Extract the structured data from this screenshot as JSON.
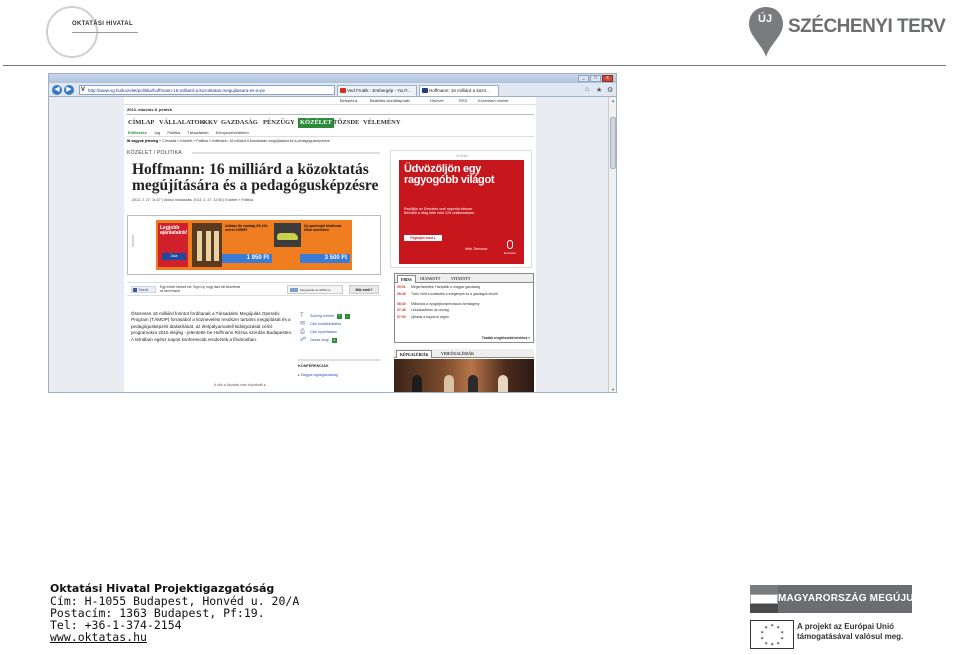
{
  "header": {
    "left_logo_text": "OKTATÁSI HIVATAL",
    "right_logo": {
      "prefix": "ÚJ",
      "name": "SZÉCHENYI TERV"
    }
  },
  "browser": {
    "url": "http://www.vg.hu/kozelet/politika/hoffmann-16-milliard-a-kozoktatas-megujitasara-es-a-pe",
    "tabs": [
      {
        "label": "Ved Fruttik - Embergép - YouT...",
        "icon": "youtube-icon"
      },
      {
        "label": "Hoffmann: 16 milliárd a közö...",
        "icon": "vg-icon"
      }
    ],
    "window_buttons": [
      "_",
      "□",
      "x"
    ],
    "favorites_bar": [
      "Belépés ▸",
      "Beállítás kezdőlapnak!",
      "Hírlevél",
      "RSS",
      "Kövessen minket"
    ]
  },
  "page": {
    "date": "2013. március 8. péntek",
    "main_nav": [
      "CÍMLAP",
      "VÁLLALATOK",
      "KKV",
      "GAZDASÁG",
      "PÉNZÜGY",
      "KÖZÉLET",
      "TŐZSDE",
      "VÉLEMÉNY"
    ],
    "main_nav_active": "KÖZÉLET",
    "sub_nav": [
      "Előfizetés",
      "Jog",
      "Politika",
      "Társadalom",
      "Környezetvédelem"
    ],
    "breadcrumb_prefix": "Itt vagyok jelenleg",
    "breadcrumb": "Címoldal  »  Közélet  »  Politika  »  Hoffmann: 16 milliárd a közoktatás megújítására és a pedagógusképzésre",
    "section": "KÖZÉLET / POLITIKA",
    "headline": "Hoffmann: 16 milliárd a közoktatás megújítására és a pedagógusképzésre",
    "meta": "2013. 2. 27. 11:07 | Utolsó módosítás: 2013. 2. 27. 12:50 | Közélet » Politika",
    "ad": {
      "label": "Hirdetés",
      "left_title": "Legjobb ajánlataink!",
      "left_brand": "Alza",
      "product1_text": "Adidas fiú nadrág 05-164 méret 1950Ft",
      "product1_price": "1 950 Ft",
      "product2_text": "Új sportcipő kisfiúnak több méretben",
      "product2_price": "3 500 Ft"
    },
    "share": {
      "like": "Tetszik",
      "fb_text": "Egy ember kedveli ezt. Sign Up, hogy lásd mit kedvelnek az ismerőseid.",
      "share_button": "Megosztás az iWIW-en",
      "mi_ez": "Mik ezek?"
    },
    "lead": "Összesen 16 milliárd forintot fordítanak a Társadalmi Megújulás Operatív Program (TÁMOP) forrásából a köznevelési rendszer tartalmi megújítását és a pedagógusképzés átalakítását, az életpályamodell kidolgozását célzó programokra 2015 elejéig - jelentette be Hoffmann Rózsa szerdán Budapesten. A témában egész napos konferenciát rendeztek a fővárosban.",
    "tools": [
      {
        "icon": "text-size-icon",
        "label": "Szöveg mérete",
        "extra": [
          "+",
          "-"
        ]
      },
      {
        "icon": "mail-icon",
        "label": "Cikk továbbküldése",
        "extra": []
      },
      {
        "icon": "print-icon",
        "label": "Cikk nyomtatása",
        "extra": []
      },
      {
        "icon": "share-icon",
        "label": "Ossza meg!",
        "extra": [
          "▸"
        ]
      }
    ],
    "konferenciak_title": "KONFERENCIÁK",
    "konferenciak_item": "▸ Magyar agrárgazdaság",
    "bottom_note": "A cikk a folytatás után folytatódik ▸",
    "right_ad_label": "Hirdetés",
    "emirates": {
      "title": "Üdvözöljön egy ragyogóbb világot",
      "subtitle": "Repüljön az Emirates-szel naponta kétszer Bécsből a világ több mint 125 célállomására",
      "button": "Foglaljon most ▸",
      "slogan": "Hello Tomorrow",
      "logo": "Emirates"
    },
    "news_tabs": [
      "FRISS",
      "OLVASOTT",
      "VITATOTT"
    ],
    "news": [
      {
        "time": "09:01",
        "text": "Megerősítették: Hanyatlik a magyar gazdaság"
      },
      {
        "time": "08:45",
        "text": "Tárki: Nőtt a szakadék a szegények és a gazdagok között"
      },
      {
        "time": "08:30",
        "text": "Milliárdos a nyugdíjkompenzációs forrásigény"
      },
      {
        "time": "07:45",
        "text": "Leszakadóban az ország"
      },
      {
        "time": "07:00",
        "text": "Újításai a kuponos cégek"
      }
    ],
    "news_more": "Tovább a legfrissebb hírekhez »",
    "gallery_tabs": [
      "KÉPGALÉRIÁK",
      "VIDEÓGALÉRIÁK"
    ]
  },
  "footer": {
    "lines": [
      "Oktatási Hivatal Projektigazgatóság",
      "Cím: H-1055 Budapest, Honvéd u. 20/A",
      "Postacím: 1363 Budapest, Pf:19.",
      "Tel: +36-1-374-2154",
      "www.oktatas.hu"
    ],
    "mm_logo_text": "MAGYARORSZÁG MEGÚJUL",
    "eu_text": [
      "A projekt az Európai Unió",
      "támogatásával valósul meg."
    ]
  },
  "colors": {
    "accent_green": "#2c8a3a",
    "emirates_red": "#c8161d",
    "ad_orange": "#f07e20",
    "szechenyi_gray": "#6d6e70"
  }
}
